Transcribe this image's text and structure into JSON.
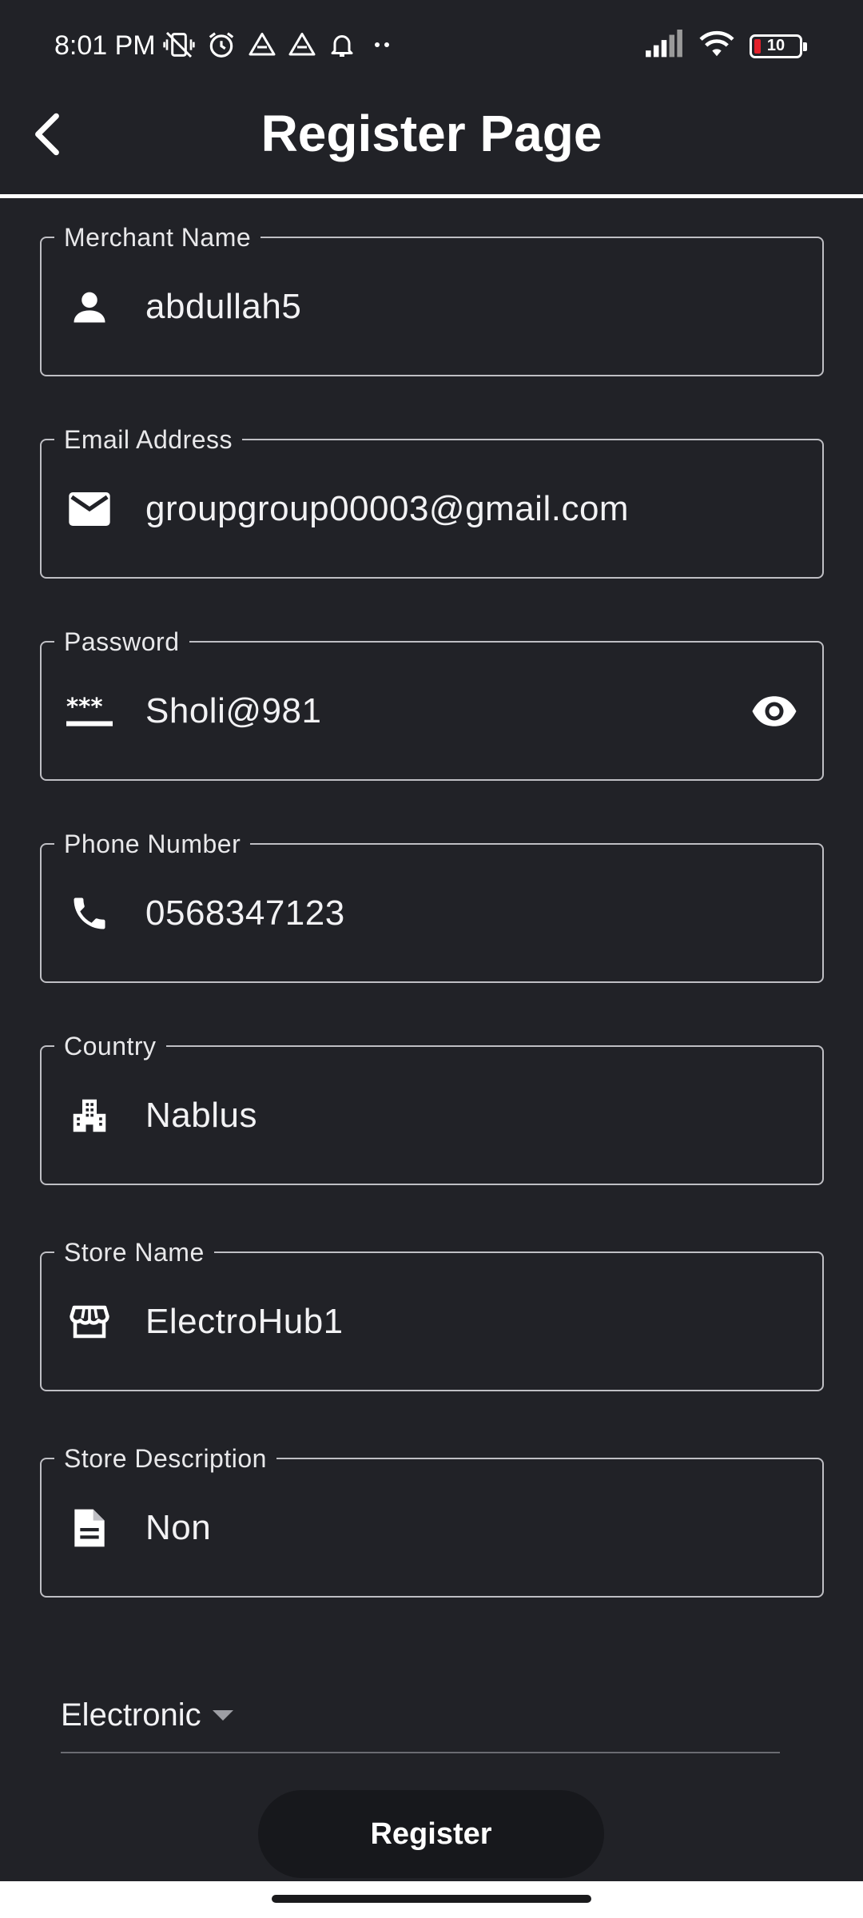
{
  "status_bar": {
    "time": "8:01 PM",
    "battery_level": "10",
    "left_icons": [
      "vibrate-off-icon",
      "alarm-icon",
      "drive-icon",
      "drive-icon",
      "bell-icon",
      "more-dots-icon"
    ],
    "right_icons": [
      "signal-icon",
      "wifi-icon",
      "battery-icon"
    ]
  },
  "app_bar": {
    "title": "Register Page",
    "back_icon": "chevron-left-icon"
  },
  "form": {
    "merchant_name": {
      "label": "Merchant Name",
      "value": "abdullah5",
      "icon": "person-icon"
    },
    "email": {
      "label": "Email Address",
      "value": "groupgroup00003@gmail.com",
      "icon": "mail-icon"
    },
    "password": {
      "label": "Password",
      "value": "Sholi@981",
      "icon": "password-icon",
      "trailing_icon": "eye-icon"
    },
    "phone": {
      "label": "Phone Number",
      "value": "0568347123",
      "icon": "phone-icon"
    },
    "country": {
      "label": "Country",
      "value": "Nablus",
      "icon": "city-icon"
    },
    "store_name": {
      "label": "Store Name",
      "value": "ElectroHub1",
      "icon": "store-icon"
    },
    "store_description": {
      "label": "Store Description",
      "value": "Non",
      "icon": "document-icon"
    },
    "category": {
      "selected": "Electronic"
    }
  },
  "actions": {
    "register_label": "Register"
  },
  "colors": {
    "background": "#212227",
    "field_border": "#bfbfc4",
    "button_bg": "#17181c",
    "text": "#ffffff"
  }
}
